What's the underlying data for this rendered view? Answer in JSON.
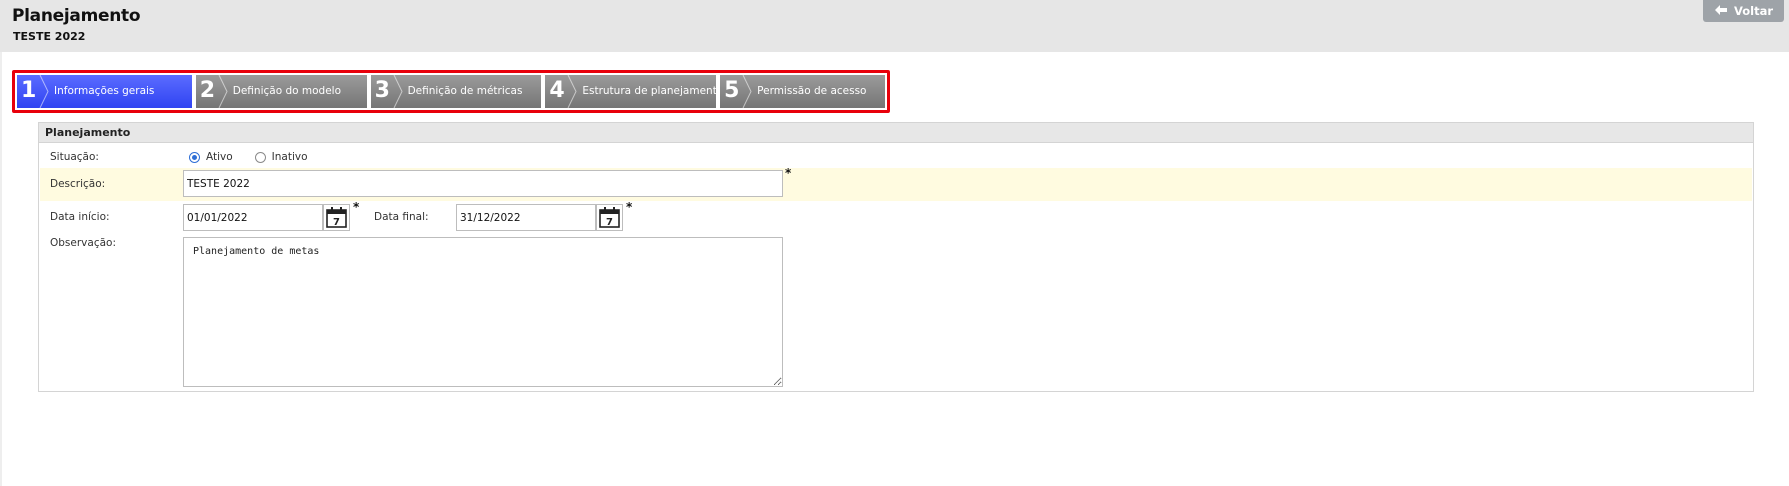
{
  "header": {
    "title": "Planejamento",
    "subtitle": "TESTE 2022",
    "back_label": "Voltar",
    "back_icon": "arrow-left-icon"
  },
  "wizard": {
    "steps": [
      {
        "number": "1",
        "label": "Informações gerais",
        "active": true
      },
      {
        "number": "2",
        "label": "Definição do modelo",
        "active": false
      },
      {
        "number": "3",
        "label": "Definição de métricas",
        "active": false
      },
      {
        "number": "4",
        "label": "Estrutura de planejamento",
        "active": false
      },
      {
        "number": "5",
        "label": "Permissão de acesso",
        "active": false
      }
    ],
    "active_color": "#3a4cf5",
    "inactive_color": "#858585",
    "highlight_color": "#e8000b"
  },
  "panel": {
    "title": "Planejamento",
    "situacao": {
      "label": "Situação:",
      "options": [
        "Ativo",
        "Inativo"
      ],
      "selected": "Ativo"
    },
    "descricao": {
      "label": "Descrição:",
      "value": "TESTE 2022",
      "required_mark": "*"
    },
    "data_inicio": {
      "label": "Data início:",
      "value": "01/01/2022",
      "required_mark": "*",
      "calendar_day": "7"
    },
    "data_final": {
      "label": "Data final:",
      "value": "31/12/2022",
      "required_mark": "*",
      "calendar_day": "7"
    },
    "observacao": {
      "label": "Observação:",
      "value": "Planejamento de metas"
    }
  }
}
